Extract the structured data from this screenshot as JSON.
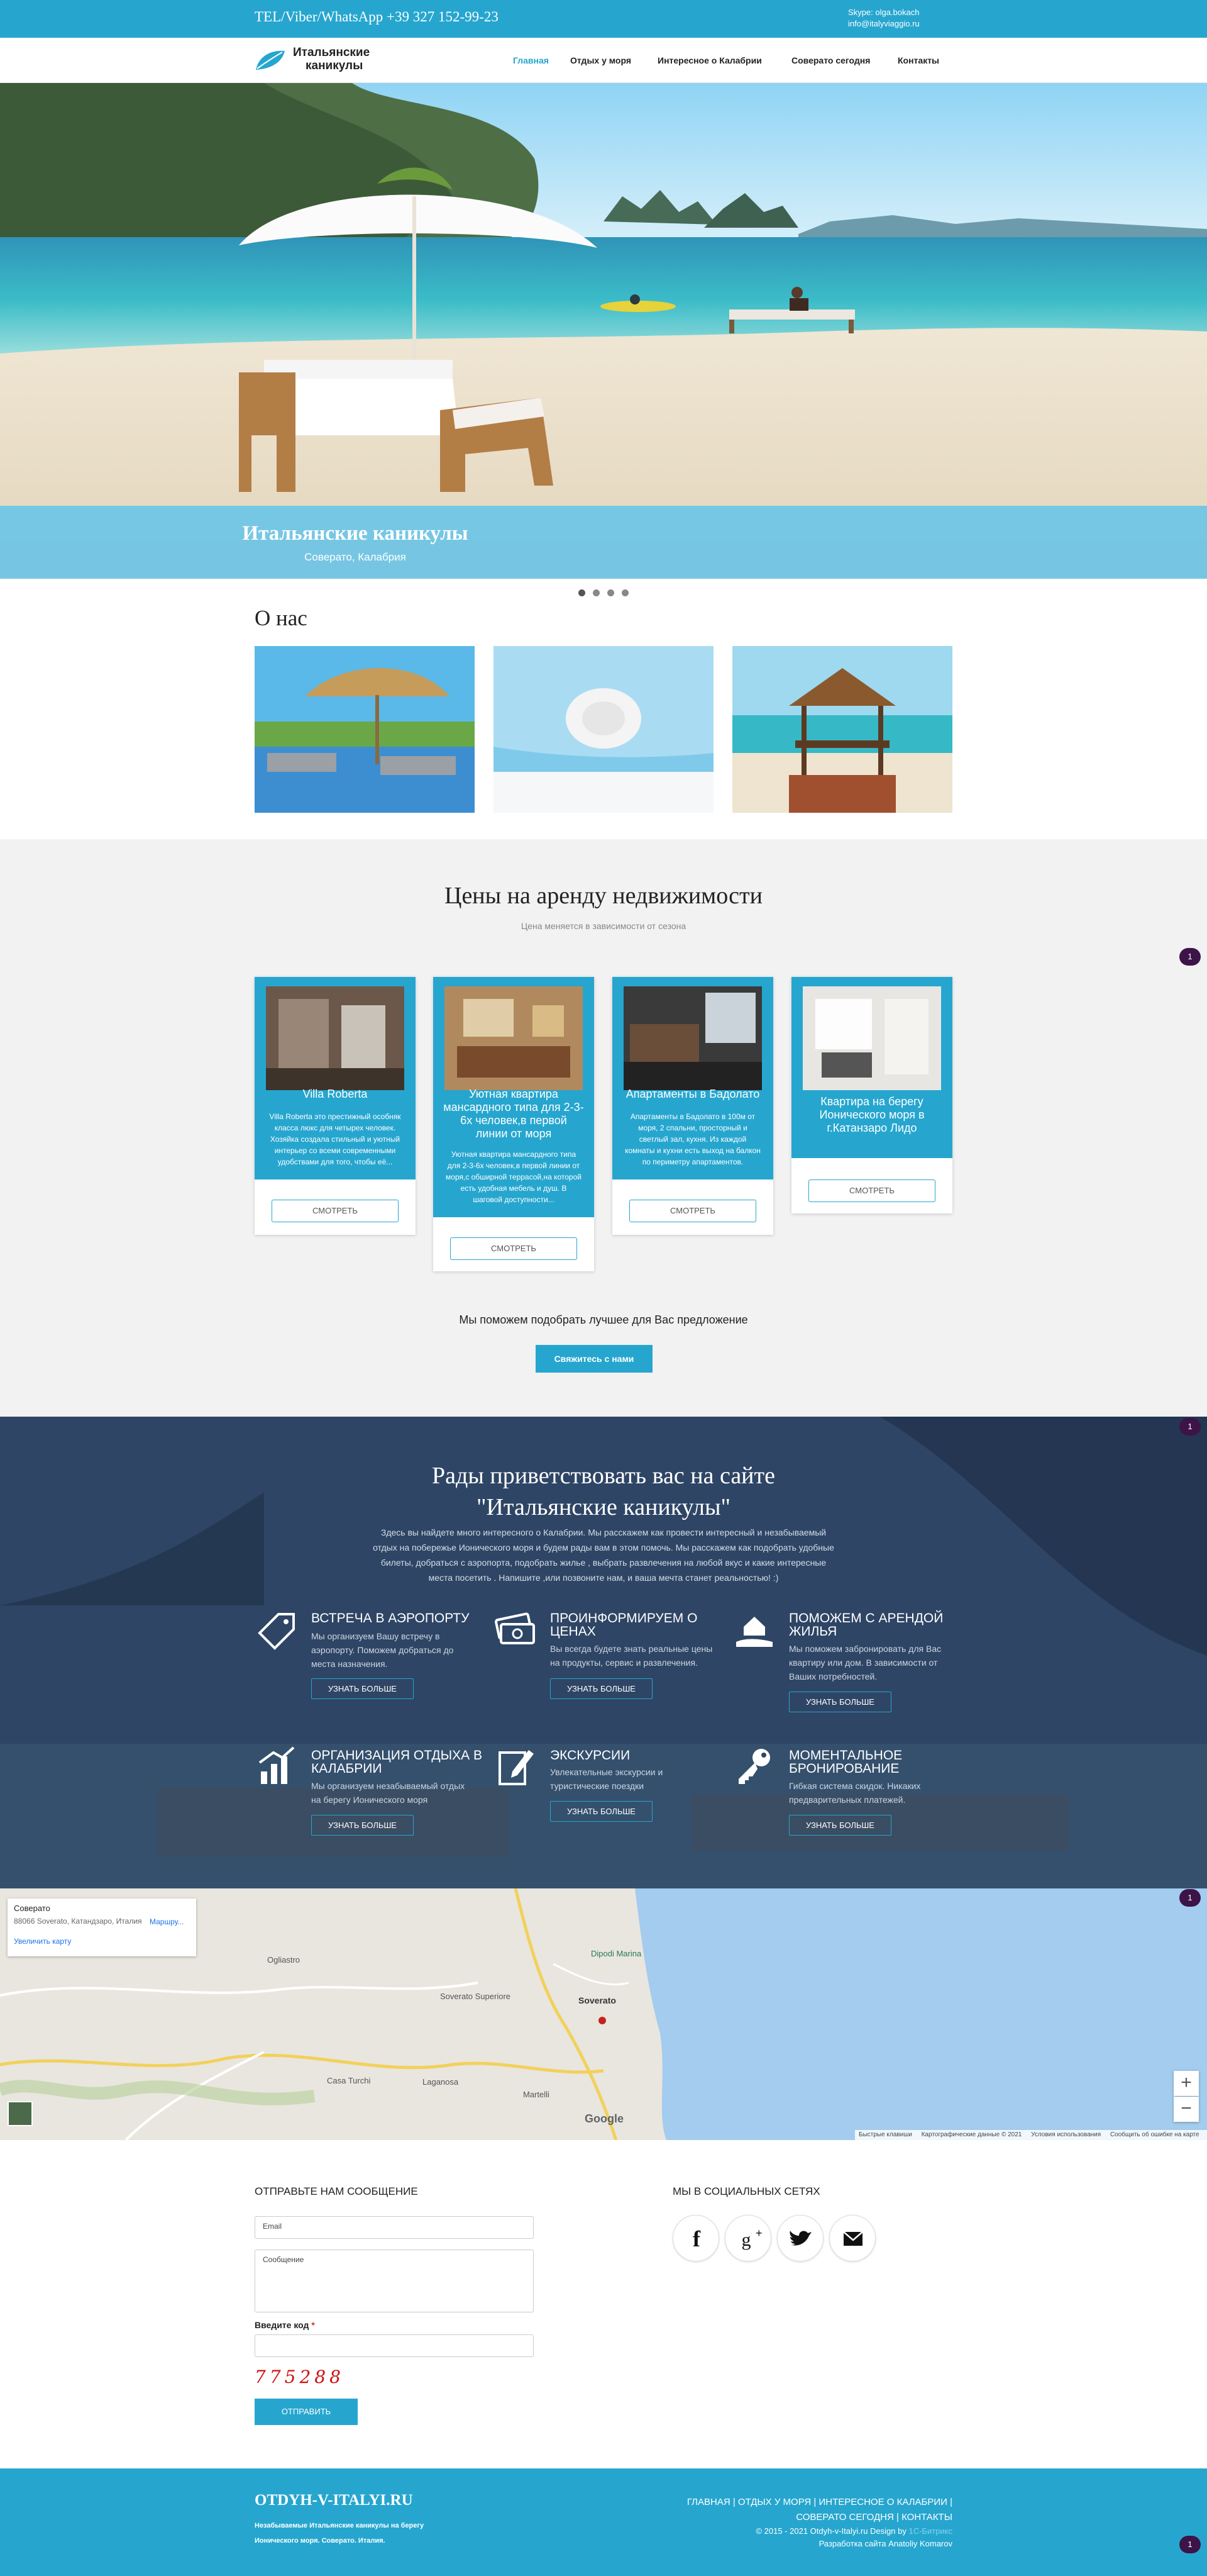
{
  "topbar": {
    "phone": "TEL/Viber/WhatsApp +39 327 152-99-23",
    "skype": "Skype: olga.bokach",
    "email": "info@italyviaggio.ru"
  },
  "logo": {
    "line1": "Итальянские",
    "line2": "каникулы"
  },
  "nav": {
    "items": [
      "Главная",
      "Отдых у моря",
      "Интересное о Калабрии",
      "Соверато сегодня",
      "Контакты"
    ],
    "active": "Главная"
  },
  "hero": {
    "title": "Итальянские каникулы",
    "subtitle": "Соверато, Калабрия",
    "slides": 4,
    "active_slide": 1
  },
  "about": {
    "title": "О нас"
  },
  "prices": {
    "title": "Цены на аренду недвижимости",
    "subtitle": "Цена меняется в зависимости от сезона",
    "cards": [
      {
        "title": "Villa Roberta",
        "desc_lines": [
          "Villa Roberta это престижный особняк",
          "класса люкс для четырех человек.",
          "Хозяйка создала стильный и уютный",
          "интерьер со всеми современными",
          "удобствами для того, чтобы её..."
        ],
        "button": "СМОТРЕТЬ"
      },
      {
        "title_lines": [
          "Уютная квартира",
          "мансардного типа для 2-3-",
          "6х человек,в первой",
          "линии от моря"
        ],
        "desc_lines": [
          "Уютная квартира мансардного типа",
          "для 2-3-6х человек,в первой линии от",
          "моря,с обширной террасой,на которой",
          "есть удобная мебель и душ. В",
          "шаговой доступности..."
        ],
        "button": "СМОТРЕТЬ"
      },
      {
        "title": "Апартаменты в Бадолато",
        "desc_lines": [
          "Апартаменты в Бадолато в 100м от",
          "моря, 2 спальни, просторный и",
          "светлый зал, кухня. Из каждой",
          "комнаты и кухни есть выход на балкон",
          "по периметру апартаментов."
        ],
        "button": "СМОТРЕТЬ"
      },
      {
        "title_lines": [
          "Квартира на берегу",
          "Ионического моря в",
          "г.Катанзаро Лидо"
        ],
        "button": "СМОТРЕТЬ"
      }
    ],
    "help_text": "Мы поможем подобрать лучшее для Вас предложение",
    "contact_button": "Свяжитесь с нами"
  },
  "badges": {
    "count": "1"
  },
  "welcome": {
    "title_line1": "Рады приветствовать вас на сайте",
    "title_line2": "\"Итальянские каникулы\"",
    "text_lines": [
      "Здесь вы найдете много интересного о Калабрии. Мы расскажем как провести интересный и незабываемый",
      "отдых на побережье Ионического моря и будем рады вам в этом помочь. Мы расскажем как подобрать удобные",
      "билеты, добраться с аэропорта, подобрать жилье , выбрать развлечения на любой вкус и какие интересные",
      "места посетить . Напишите ,или позвоните нам, и ваша мечта станет реальностью! :)"
    ],
    "services": [
      {
        "icon": "tag-icon",
        "title_lines": [
          "ВСТРЕЧА В АЭРОПОРТУ"
        ],
        "text_lines": [
          "Мы организуем Вашу встречу в",
          "аэропорту. Поможем добраться до",
          "места назначения."
        ],
        "button": "УЗНАТЬ БОЛЬШЕ"
      },
      {
        "icon": "money-icon",
        "title_lines": [
          "ПРОИНФОРМИРУЕМ О",
          "ЦЕНАХ"
        ],
        "text_lines": [
          "Вы всегда будете знать реальные цены",
          "на продукты, сервис и развлечения."
        ],
        "button": "УЗНАТЬ БОЛЬШЕ"
      },
      {
        "icon": "home-hand-icon",
        "title_lines": [
          "ПОМОЖЕМ С АРЕНДОЙ",
          "ЖИЛЬЯ"
        ],
        "text_lines": [
          "Мы поможем забронировать для Вас",
          "квартиру или дом. В зависимости от",
          "Ваших потребностей."
        ],
        "button": "УЗНАТЬ БОЛЬШЕ"
      },
      {
        "icon": "chart-icon",
        "title_lines": [
          "ОРГАНИЗАЦИЯ ОТДЫХА В",
          "КАЛАБРИИ"
        ],
        "text_lines": [
          "Мы организуем незабываемый отдых",
          "на берегу Ионического моря"
        ],
        "button": "УЗНАТЬ БОЛЬШЕ"
      },
      {
        "icon": "edit-icon",
        "title_lines": [
          "ЭКСКУРСИИ"
        ],
        "text_lines": [
          "Увлекательные экскурсии и",
          "туристические поездки"
        ],
        "button": "УЗНАТЬ БОЛЬШЕ"
      },
      {
        "icon": "key-icon",
        "title_lines": [
          "МОМЕНТАЛЬНОЕ",
          "БРОНИРОВАНИЕ"
        ],
        "text_lines": [
          "Гибкая система скидок. Никаких",
          "предварительных платежей."
        ],
        "button": "УЗНАТЬ БОЛЬШЕ"
      }
    ]
  },
  "map": {
    "place": "Соверато",
    "address": "88066 Soverato, Катандзаро, Италия",
    "route": "Маршру...",
    "zoom_link": "Увеличить карту",
    "labels": [
      "Ogliastro",
      "Soverato Superiore",
      "Soverato",
      "Casa Turchi",
      "Laganosa",
      "Martelli",
      "Dipodi Marina"
    ],
    "footer_links": [
      "Быстрые клавиши",
      "Картографические данные © 2021",
      "Условия использования",
      "Сообщить об ошибке на карте"
    ],
    "google": "Google"
  },
  "contact": {
    "heading": "ОТПРАВЬТЕ НАМ СООБЩЕНИЕ",
    "email_placeholder": "Email",
    "message_placeholder": "Сообщение",
    "code_label": "Введите код",
    "required_mark": "*",
    "captcha": "775288",
    "send": "ОТПРАВИТЬ"
  },
  "social": {
    "heading": "МЫ В СОЦИАЛЬНЫХ СЕТЯХ",
    "items": [
      "facebook-icon",
      "google-plus-icon",
      "twitter-icon",
      "mail-icon"
    ]
  },
  "footer": {
    "brand": "OTDYH-V-ITALYI.RU",
    "desc_line1": "Незабываемые Итальянские каникулы на берегу",
    "desc_line2": "Ионического моря. Соверато. Италия.",
    "links": [
      "ГЛАВНАЯ",
      "ОТДЫХ У МОРЯ",
      "ИНТЕРЕСНОЕ О КАЛАБРИИ",
      "СОВЕРАТО СЕГОДНЯ",
      "КОНТАКТЫ"
    ],
    "copyright": "© 2015 - 2021 Otdyh-v-Italyi.ru Design by",
    "bitrix": "1С-Битрикс",
    "developer": "Разработка сайта Anatoliy Komarov"
  },
  "colors": {
    "accent": "#26a6cf",
    "dark": "#2a3e5a",
    "badge": "#3d1448"
  }
}
